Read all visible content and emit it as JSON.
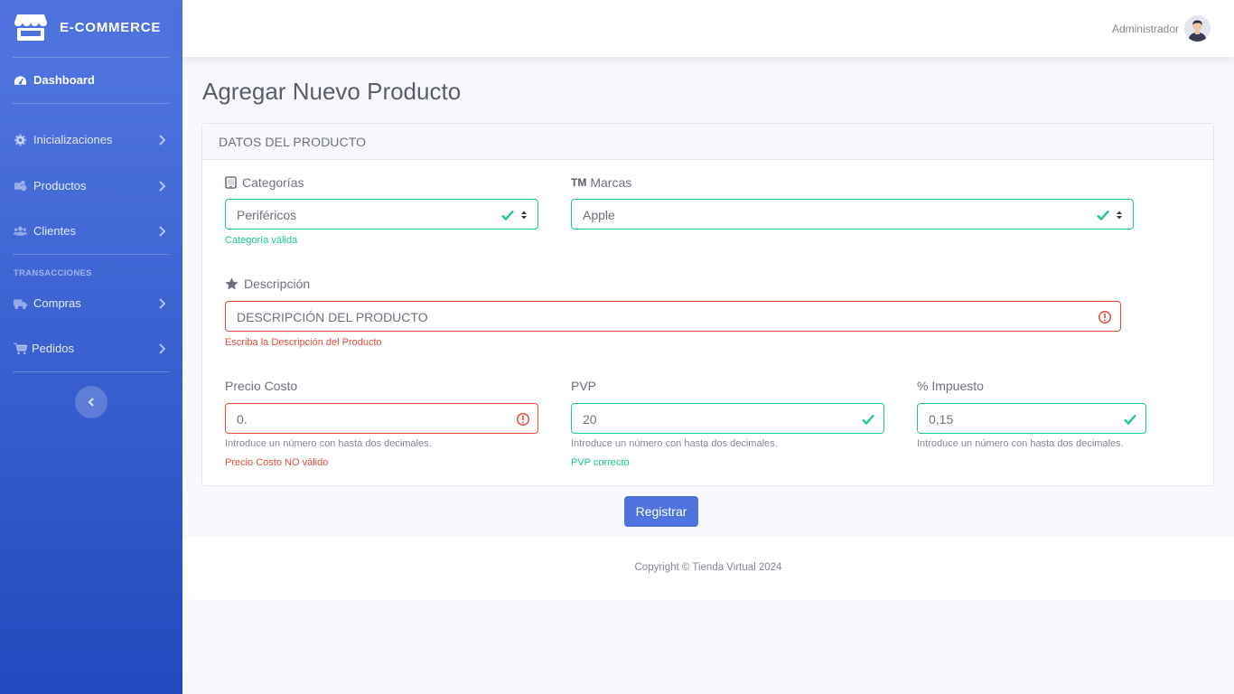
{
  "brand": {
    "name": "E-COMMERCE",
    "icon": "store-icon"
  },
  "sidebar": {
    "dashboard": "Dashboard",
    "items": [
      {
        "label": "Inicializaciones",
        "icon": "gear-icon"
      },
      {
        "label": "Productos",
        "icon": "products-icon"
      },
      {
        "label": "Clientes",
        "icon": "users-icon"
      }
    ],
    "heading": "TRANSACCIONES",
    "transactions": [
      {
        "label": "Compras",
        "icon": "truck-icon"
      },
      {
        "label": "Pedidos",
        "icon": "cart-icon"
      }
    ]
  },
  "topbar": {
    "user": "Administrador"
  },
  "page": {
    "title": "Agregar Nuevo Producto"
  },
  "card": {
    "header": "DATOS DEL PRODUCTO"
  },
  "form": {
    "categoria": {
      "label": "Categorías",
      "value": "Periféricos",
      "feedback": "Categoría válida"
    },
    "marca": {
      "label": "Marcas",
      "prefix": "TM",
      "value": "Apple"
    },
    "descripcion": {
      "label": "Descripción",
      "placeholder": "DESCRIPCIÓN DEL PRODUCTO",
      "feedback": "Escriba la Descripción del Producto"
    },
    "precio_costo": {
      "label": "Precio Costo",
      "value": "0.",
      "hint": "Introduce un número con hasta dos decimales.",
      "feedback": "Precio Costo NO válido"
    },
    "pvp": {
      "label": "PVP",
      "value": "20",
      "hint": "Introduce un número con hasta dos decimales.",
      "feedback": "PVP correcto"
    },
    "impuesto": {
      "label": "% Impuesto",
      "value": "0,15",
      "hint": "Introduce un número con hasta dos decimales."
    }
  },
  "actions": {
    "submit": "Registrar"
  },
  "footer": {
    "copyright": "Copyright © Tienda Virtual 2024"
  },
  "colors": {
    "primary": "#4e73df",
    "success": "#1cc88a",
    "danger": "#e74a3b"
  }
}
